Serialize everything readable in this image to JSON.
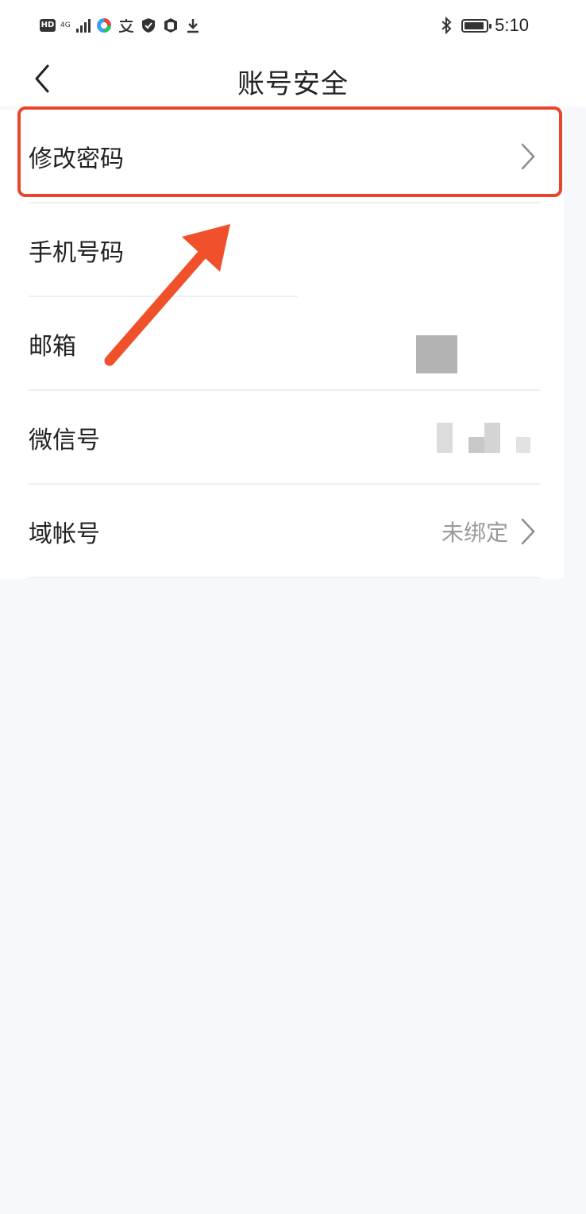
{
  "status_bar": {
    "hd_badge": "HD",
    "network_type": "4G",
    "time": "5:10",
    "icons_left": [
      "hd-icon",
      "signal-icon",
      "app-icon",
      "translate-icon",
      "shield-icon",
      "hand-icon",
      "download-icon"
    ],
    "icons_right": [
      "bluetooth-icon",
      "battery-icon"
    ],
    "battery_level": 0.9
  },
  "nav": {
    "title": "账号安全",
    "back_icon": "chevron-left-icon"
  },
  "settings": {
    "items": [
      {
        "label": "修改密码",
        "value": "",
        "has_chevron": true
      },
      {
        "label": "手机号码",
        "value": "",
        "has_chevron": false
      },
      {
        "label": "邮箱",
        "value": "",
        "has_chevron": false
      },
      {
        "label": "微信号",
        "value": "",
        "has_chevron": true
      },
      {
        "label": "域帐号",
        "value": "未绑定",
        "has_chevron": true
      }
    ]
  },
  "annotation": {
    "highlight_color": "#e8452c",
    "arrow_color": "#f0502a"
  },
  "colors": {
    "page_background": "#f7f8fc",
    "list_background": "#ffffff",
    "secondary_text": "#9a9a9a"
  }
}
